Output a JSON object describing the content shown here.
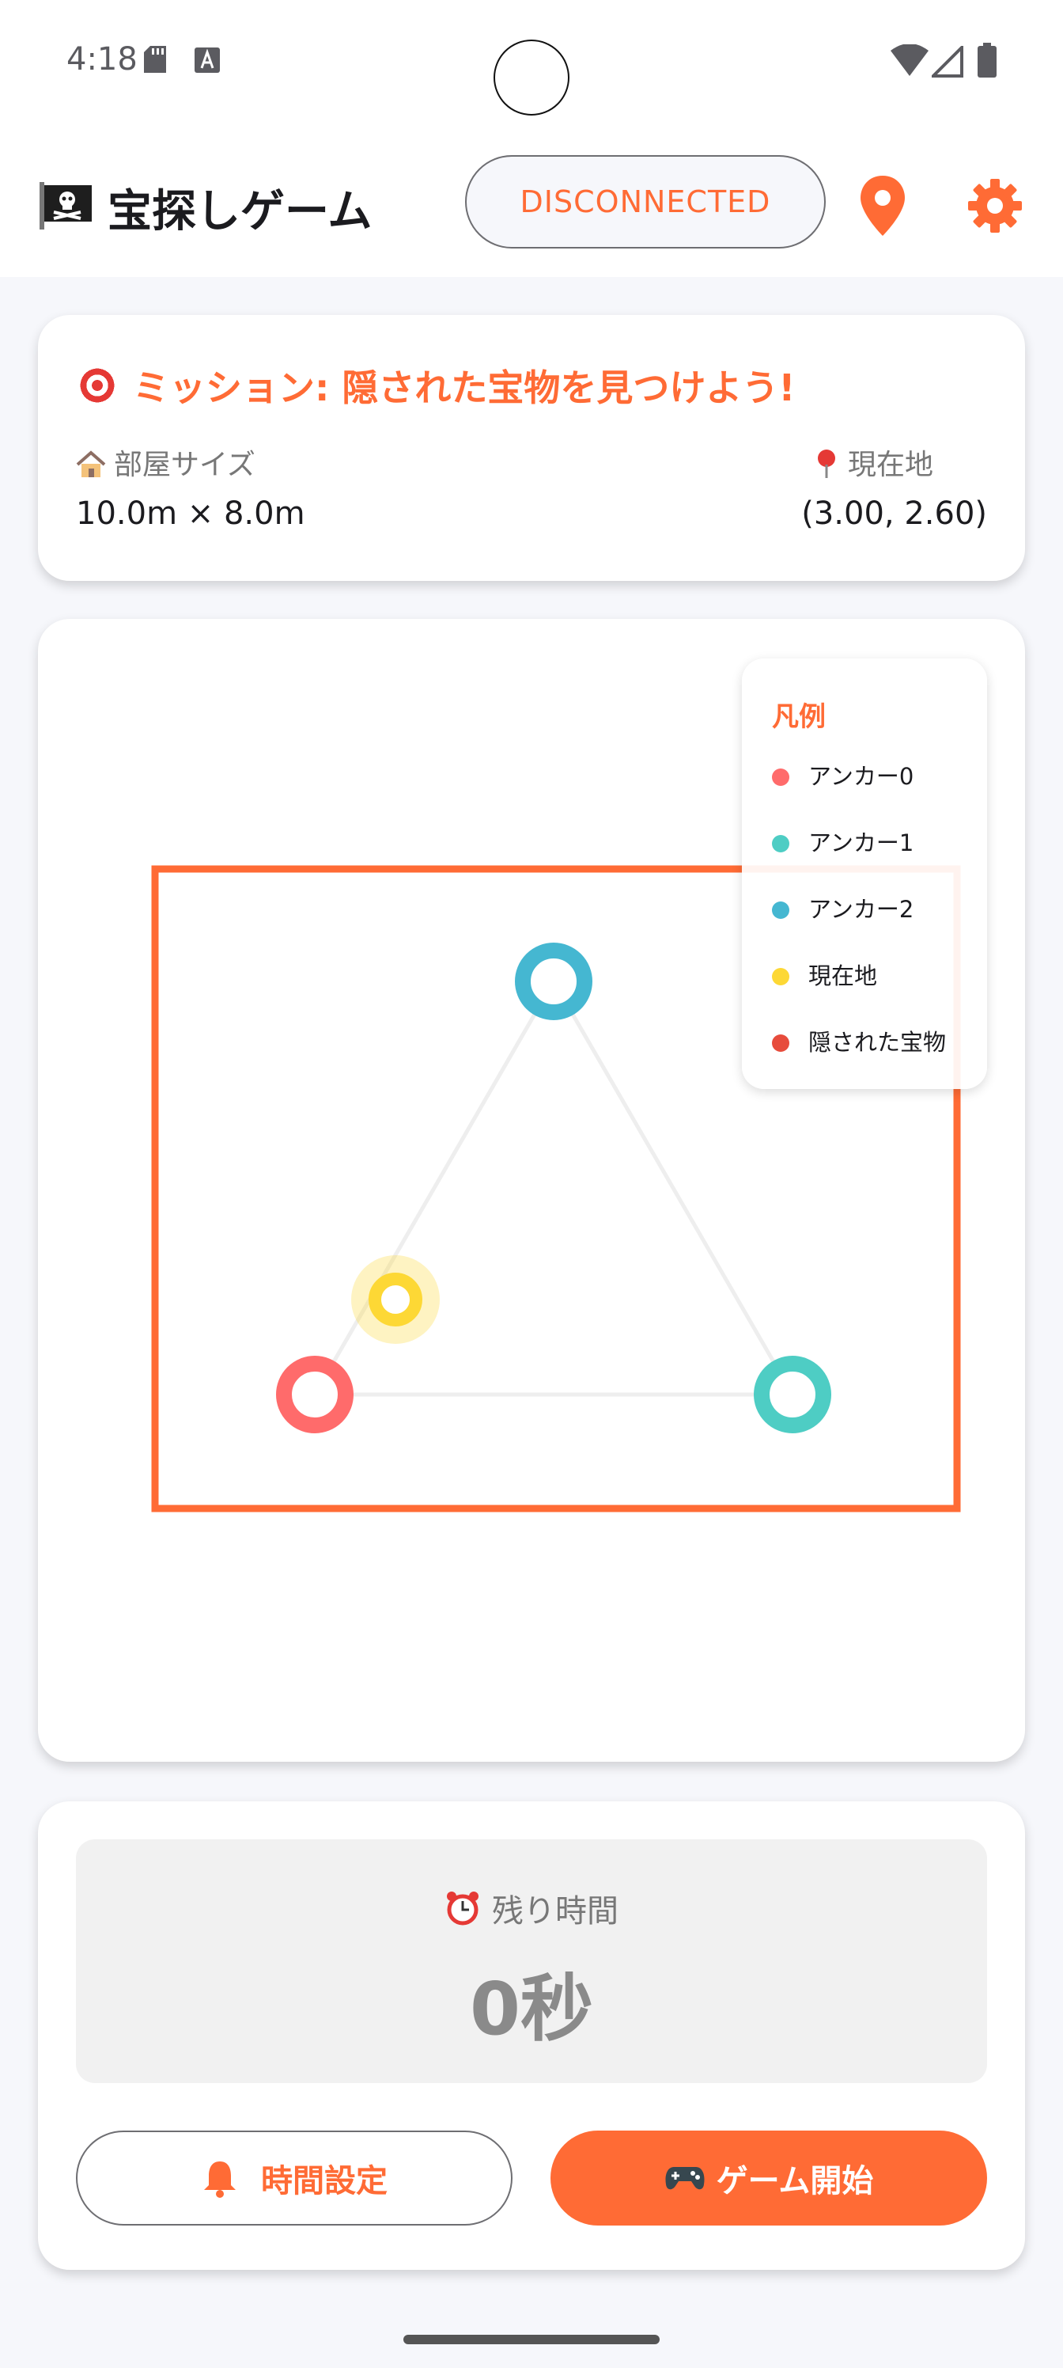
{
  "status_bar": {
    "time": "4:18"
  },
  "app_bar": {
    "title": "宝探しゲーム",
    "connection_status": "DISCONNECTED",
    "accent_color": "#ff6b35"
  },
  "mission": {
    "title": "ミッション: 隠された宝物を見つけよう!",
    "room_size_label": "部屋サイズ",
    "room_size_value": "10.0m × 8.0m",
    "position_label": "現在地",
    "position_value": "(3.00, 2.60)"
  },
  "legend": {
    "title": "凡例",
    "items": [
      {
        "label": "アンカー0",
        "color": "#ff6b6b"
      },
      {
        "label": "アンカー1",
        "color": "#4ecdc4"
      },
      {
        "label": "アンカー2",
        "color": "#45b7d1"
      },
      {
        "label": "現在地",
        "color": "#fdd835"
      },
      {
        "label": "隠された宝物",
        "color": "#e74c3c"
      }
    ]
  },
  "timer": {
    "label": "残り時間",
    "value": "0秒"
  },
  "buttons": {
    "set_time": "時間設定",
    "start_game": "ゲーム開始"
  }
}
